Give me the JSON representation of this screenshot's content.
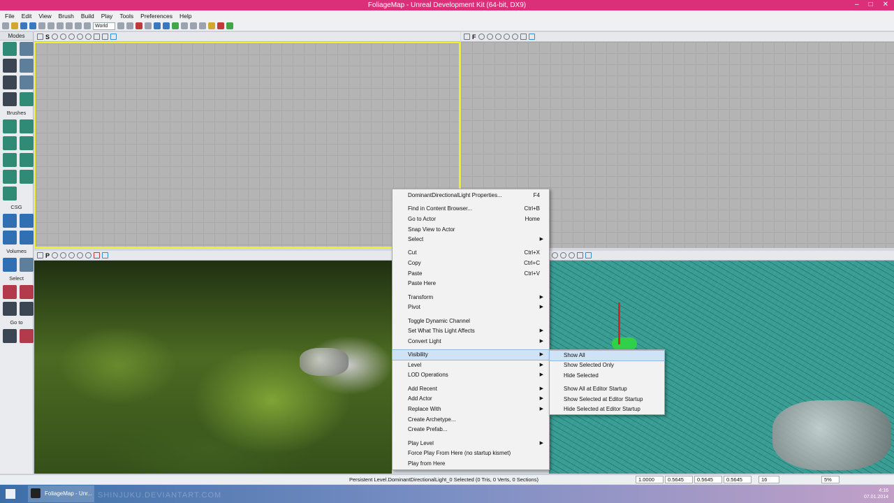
{
  "window": {
    "title": "FoliageMap - Unreal Development Kit (64-bit, DX9)"
  },
  "menubar": [
    "File",
    "Edit",
    "View",
    "Brush",
    "Build",
    "Play",
    "Tools",
    "Preferences",
    "Help"
  ],
  "toolbar": {
    "world_select": "World"
  },
  "modes_panel": {
    "header": "Modes",
    "sections": {
      "brushes": "Brushes",
      "csg": "CSG",
      "volumes": "Volumes",
      "select": "Select",
      "goto": "Go to"
    }
  },
  "viewports": {
    "top_left": {
      "kind": "grid",
      "selected": true
    },
    "top_right": {
      "kind": "grid"
    },
    "bottom_left": {
      "kind": "perspective-jungle"
    },
    "bottom_right": {
      "kind": "wireframe"
    },
    "flag_label": "F",
    "play_label": "P"
  },
  "context_menu": {
    "items": [
      {
        "label": "DominantDirectionalLight Properties...",
        "shortcut": "F4"
      },
      {
        "label": "Find in Content Browser...",
        "shortcut": "Ctrl+B"
      },
      {
        "label": "Go to Actor",
        "shortcut": "Home"
      },
      {
        "label": "Snap View to Actor",
        "shortcut": ""
      },
      {
        "label": "Select",
        "shortcut": "",
        "submenu": true
      },
      {
        "label": "Cut",
        "shortcut": "Ctrl+X"
      },
      {
        "label": "Copy",
        "shortcut": "Ctrl+C"
      },
      {
        "label": "Paste",
        "shortcut": "Ctrl+V"
      },
      {
        "label": "Paste Here",
        "shortcut": ""
      },
      {
        "label": "Transform",
        "shortcut": "",
        "submenu": true
      },
      {
        "label": "Pivot",
        "shortcut": "",
        "submenu": true
      },
      {
        "label": "Toggle Dynamic Channel",
        "shortcut": ""
      },
      {
        "label": "Set What This Light Affects",
        "shortcut": "",
        "submenu": true
      },
      {
        "label": "Convert Light",
        "shortcut": "",
        "submenu": true
      },
      {
        "label": "Visibility",
        "shortcut": "",
        "submenu": true,
        "selected": true
      },
      {
        "label": "Level",
        "shortcut": "",
        "submenu": true
      },
      {
        "label": "LOD Operations",
        "shortcut": "",
        "submenu": true
      },
      {
        "label": "Add Recent",
        "shortcut": "",
        "submenu": true
      },
      {
        "label": "Add Actor",
        "shortcut": "",
        "submenu": true
      },
      {
        "label": "Replace With",
        "shortcut": "",
        "submenu": true
      },
      {
        "label": "Create Archetype...",
        "shortcut": ""
      },
      {
        "label": "Create Prefab...",
        "shortcut": ""
      },
      {
        "label": "Play Level",
        "shortcut": "",
        "submenu": true
      },
      {
        "label": "Force Play From Here (no startup kismet)",
        "shortcut": ""
      },
      {
        "label": "Play from Here",
        "shortcut": ""
      }
    ]
  },
  "visibility_submenu": {
    "items": [
      {
        "label": "Show All",
        "selected": true
      },
      {
        "label": "Show Selected Only"
      },
      {
        "label": "Hide Selected"
      },
      {
        "label": "Show All at Editor Startup"
      },
      {
        "label": "Show Selected at Editor Startup"
      },
      {
        "label": "Hide Selected at Editor Startup"
      }
    ]
  },
  "statusbar": {
    "message": "Persistent Level.DominantDirectionalLight_0 Selected (0 Tris, 0 Verts, 0 Sections)",
    "drag_grid": "1.0000",
    "x": "0.5645",
    "y": "0.5645",
    "z": "0.5645",
    "grid_size": "16",
    "rot": "5%"
  },
  "taskbar": {
    "task_label": "FoliageMap - Unr...",
    "watermark": "SHINJUKU.DEVIANTART.COM",
    "time": "4:16",
    "date": "07.01.2014"
  }
}
